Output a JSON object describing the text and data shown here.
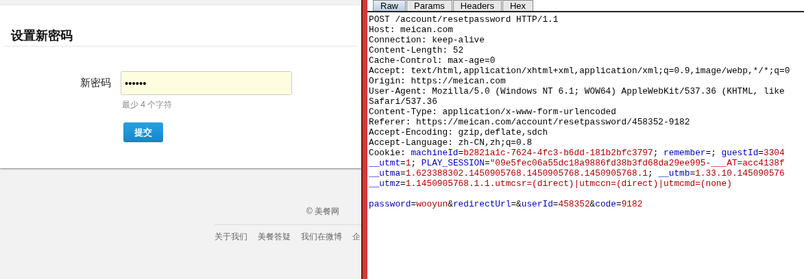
{
  "page": {
    "heading": "设置新密码",
    "field": {
      "label": "新密码",
      "value": "••••••",
      "hint": "最少 4 个字符"
    },
    "submit": "提交",
    "copyright": "© 美餐网",
    "footer_links": [
      "关于我们",
      "美餐答疑",
      "我们在微博",
      "企"
    ]
  },
  "inspector": {
    "tabs": [
      {
        "label": "Raw",
        "selected": true
      },
      {
        "label": "Params",
        "selected": false
      },
      {
        "label": "Headers",
        "selected": false
      },
      {
        "label": "Hex",
        "selected": false
      }
    ],
    "lines": [
      [
        {
          "kind": "plain",
          "text": "POST /account/resetpassword HTTP/1.1"
        }
      ],
      [
        {
          "kind": "plain",
          "text": "Host: meican.com"
        }
      ],
      [
        {
          "kind": "plain",
          "text": "Connection: keep-alive"
        }
      ],
      [
        {
          "kind": "plain",
          "text": "Content-Length: 52"
        }
      ],
      [
        {
          "kind": "plain",
          "text": "Cache-Control: max-age=0"
        }
      ],
      [
        {
          "kind": "plain",
          "text": "Accept: text/html,application/xhtml+xml,application/xml;q=0.9,image/webp,*/*;q=0"
        }
      ],
      [
        {
          "kind": "plain",
          "text": "Origin: https://meican.com"
        }
      ],
      [
        {
          "kind": "plain",
          "text": "User-Agent: Mozilla/5.0 (Windows NT 6.1; WOW64) AppleWebKit/537.36 (KHTML, like"
        }
      ],
      [
        {
          "kind": "plain",
          "text": "Safari/537.36"
        }
      ],
      [
        {
          "kind": "plain",
          "text": "Content-Type: application/x-www-form-urlencoded"
        }
      ],
      [
        {
          "kind": "plain",
          "text": "Referer: https://meican.com/account/resetpassword/458352-9182"
        }
      ],
      [
        {
          "kind": "plain",
          "text": "Accept-Encoding: gzip,deflate,sdch"
        }
      ],
      [
        {
          "kind": "plain",
          "text": "Accept-Language: zh-CN,zh;q=0.8"
        }
      ],
      [
        {
          "kind": "plain",
          "text": "Cookie: "
        },
        {
          "kind": "key",
          "text": "machineId"
        },
        {
          "kind": "plain",
          "text": "="
        },
        {
          "kind": "value",
          "text": "b2821a1c-7624-4fc3-b6dd-181b2bfc3797"
        },
        {
          "kind": "plain",
          "text": "; "
        },
        {
          "kind": "key",
          "text": "remember"
        },
        {
          "kind": "plain",
          "text": "=; "
        },
        {
          "kind": "key",
          "text": "guestId"
        },
        {
          "kind": "plain",
          "text": "="
        },
        {
          "kind": "value",
          "text": "3304"
        }
      ],
      [
        {
          "kind": "key",
          "text": "__utmt"
        },
        {
          "kind": "plain",
          "text": "="
        },
        {
          "kind": "value",
          "text": "1"
        },
        {
          "kind": "plain",
          "text": "; "
        },
        {
          "kind": "key",
          "text": "PLAY_SESSION"
        },
        {
          "kind": "plain",
          "text": "="
        },
        {
          "kind": "value",
          "text": "\"09e5fec06a55dc18a9886fd38b3fd68da29ee995-___AT=acc4138f"
        }
      ],
      [
        {
          "kind": "key",
          "text": "__utma"
        },
        {
          "kind": "plain",
          "text": "="
        },
        {
          "kind": "value",
          "text": "1.623388302.1450905768.1450905768.1450905768.1"
        },
        {
          "kind": "plain",
          "text": "; "
        },
        {
          "kind": "key",
          "text": "__utmb"
        },
        {
          "kind": "plain",
          "text": "="
        },
        {
          "kind": "value",
          "text": "1.33.10.145090576"
        }
      ],
      [
        {
          "kind": "key",
          "text": "__utmz"
        },
        {
          "kind": "plain",
          "text": "="
        },
        {
          "kind": "value",
          "text": "1.1450905768.1.1.utmcsr=(direct)|utmccn=(direct)|utmcmd=(none)"
        }
      ]
    ],
    "body": [
      [
        {
          "kind": "key",
          "text": "password"
        },
        {
          "kind": "plain",
          "text": "="
        },
        {
          "kind": "value",
          "text": "wooyun"
        },
        {
          "kind": "plain",
          "text": "&"
        },
        {
          "kind": "key",
          "text": "redirectUrl"
        },
        {
          "kind": "plain",
          "text": "=&"
        },
        {
          "kind": "key",
          "text": "userId"
        },
        {
          "kind": "plain",
          "text": "="
        },
        {
          "kind": "value",
          "text": "458352"
        },
        {
          "kind": "plain",
          "text": "&"
        },
        {
          "kind": "key",
          "text": "code"
        },
        {
          "kind": "plain",
          "text": "="
        },
        {
          "kind": "value",
          "text": "9182"
        }
      ]
    ]
  }
}
